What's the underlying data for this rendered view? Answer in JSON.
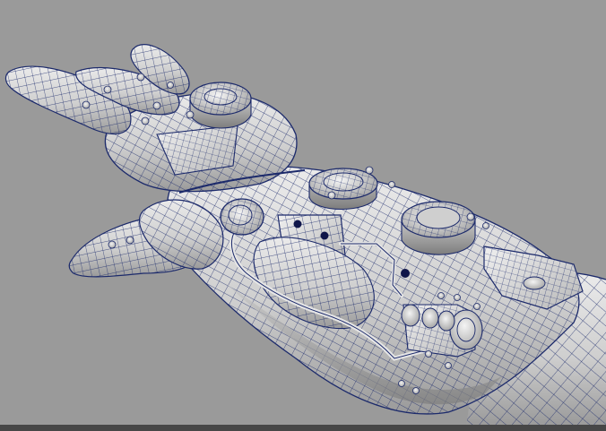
{
  "viewport": {
    "background_color": "#9a9a9a",
    "mesh_fill_light": "#e2e2e2",
    "mesh_fill_mid": "#c4c4c4",
    "mesh_fill_dark": "#8e8e8e",
    "wire_color": "#1c2a6b",
    "hole_color": "#10164a",
    "bottom_strip_color": "#474747"
  },
  "scene": {
    "subject": "wireframe-mesh-robotic-arm-gauntlet"
  }
}
